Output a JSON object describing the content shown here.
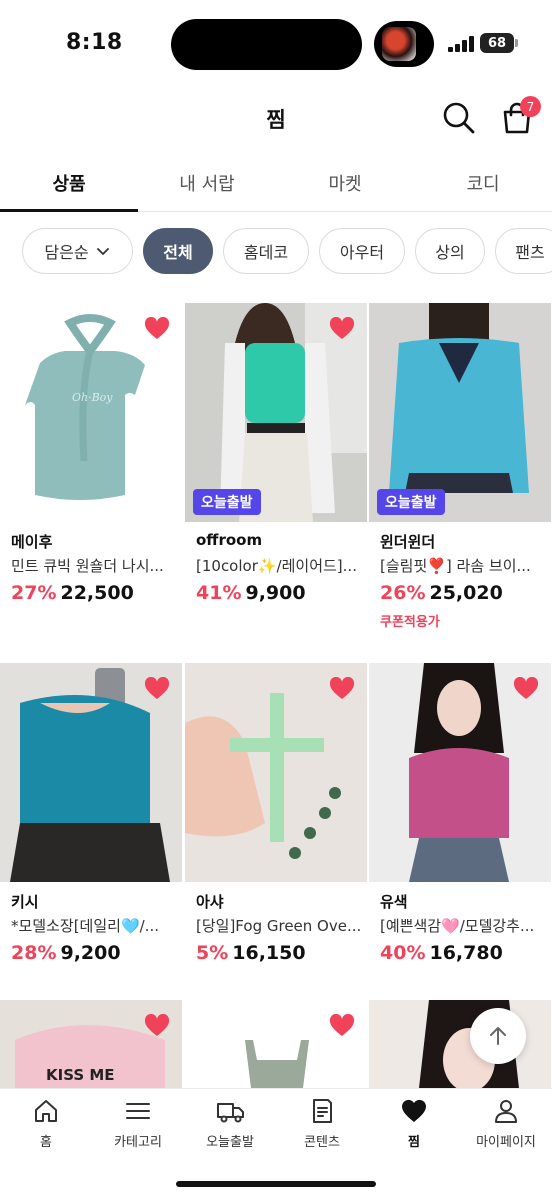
{
  "status_bar": {
    "time": "8:18",
    "battery": "68"
  },
  "header": {
    "title": "찜",
    "cart_count": "7"
  },
  "tabs": [
    {
      "label": "상품",
      "active": true
    },
    {
      "label": "내 서랍",
      "active": false
    },
    {
      "label": "마켓",
      "active": false
    },
    {
      "label": "코디",
      "active": false
    }
  ],
  "filters": {
    "sort_label": "담은순",
    "chips": [
      "전체",
      "홈데코",
      "아우터",
      "상의",
      "팬츠"
    ]
  },
  "products": [
    {
      "brand": "메이후",
      "name": "민트 큐빅 원숄더 나시...",
      "discount": "27%",
      "price": "22,500",
      "badge": "",
      "coupon": ""
    },
    {
      "brand": "offroom",
      "name": "[10color✨/레이어드]...",
      "discount": "41%",
      "price": "9,900",
      "badge": "오늘출발",
      "coupon": ""
    },
    {
      "brand": "윈더윈더",
      "name": "[슬림핏❣️] 라솜 브이...",
      "discount": "26%",
      "price": "25,020",
      "badge": "오늘출발",
      "coupon": "쿠폰적용가"
    },
    {
      "brand": "키시",
      "name": "*모델소장[데일리🩵/...",
      "discount": "28%",
      "price": "9,200",
      "badge": "",
      "coupon": ""
    },
    {
      "brand": "아샤",
      "name": "[당일]Fog Green Ove...",
      "discount": "5%",
      "price": "16,150",
      "badge": "",
      "coupon": ""
    },
    {
      "brand": "유색",
      "name": "[예쁜색감🩷/모델강추...",
      "discount": "40%",
      "price": "16,780",
      "badge": "",
      "coupon": ""
    }
  ],
  "partial_products_text": "KISS ME",
  "bottom_nav": [
    {
      "label": "홈",
      "icon": "home-icon"
    },
    {
      "label": "카테고리",
      "icon": "menu-icon"
    },
    {
      "label": "오늘출발",
      "icon": "truck-icon"
    },
    {
      "label": "콘텐츠",
      "icon": "document-icon"
    },
    {
      "label": "찜",
      "icon": "heart-icon",
      "active": true
    },
    {
      "label": "마이페이지",
      "icon": "person-icon"
    }
  ],
  "colors": {
    "accent_red": "#f0435a",
    "badge_purple": "#5546ea",
    "chip_active": "#4e5a72"
  }
}
